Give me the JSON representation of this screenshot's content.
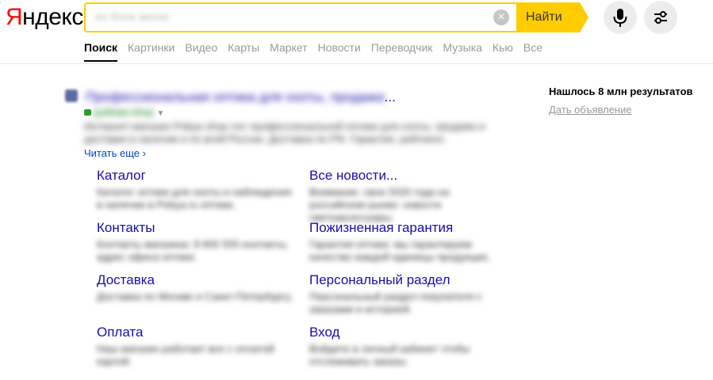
{
  "logo": {
    "first_letter": "Я",
    "rest": "ндекс"
  },
  "search": {
    "query": "из блок меню"
  },
  "buttons": {
    "find": "Найти",
    "clear": "×",
    "mic_icon": "microphone-icon",
    "settings_icon": "sliders-icon"
  },
  "tabs": [
    {
      "label": "Поиск",
      "active": true
    },
    {
      "label": "Картинки"
    },
    {
      "label": "Видео"
    },
    {
      "label": "Карты"
    },
    {
      "label": "Маркет"
    },
    {
      "label": "Новости"
    },
    {
      "label": "Переводчик"
    },
    {
      "label": "Музыка"
    },
    {
      "label": "Кью"
    },
    {
      "label": "Все"
    }
  ],
  "result": {
    "title": "Профессиональная оптика для охоты, продажа",
    "ellipsis": "...",
    "url": "рубежи.shop",
    "snippet": "Интернет-магазин Pobya shop лот профессиональной оптики для охоты, продажи и доставки в наличии и по всей России. Доставка по РФ. Гарантия, рейтинги.",
    "read_more": "Читать еще"
  },
  "sitelinks": [
    {
      "title": "Каталог",
      "text": "Каталог оптики для охоты и наблюдения в наличии в Pobya.ru оптики."
    },
    {
      "title": "Все новости...",
      "text": "Внимание: свои 2020 года на российском рынке: новости светоаксессуары."
    },
    {
      "title": "Контакты",
      "text": "Контакты магазина: 8 800 555 контакты, адрес офиса оптики."
    },
    {
      "title": "Пожизненная гарантия",
      "text": "Гарантия оптики: мы гарантируем качество каждой единицы продукции."
    },
    {
      "title": "Доставка",
      "text": "Доставка по Москве и Санкт-Петербургу."
    },
    {
      "title": "Персональный раздел",
      "text": "Персональный раздел покупателя с заказами и историей."
    },
    {
      "title": "Оплата",
      "text": "Наш магазин работает все с оплатой картой."
    },
    {
      "title": "Вход",
      "text": "Войдите в личный кабинет чтобы отслеживать заказы."
    }
  ],
  "sidebar": {
    "found": "Нашлось 8 млн результатов",
    "ad": "Дать объявление"
  }
}
